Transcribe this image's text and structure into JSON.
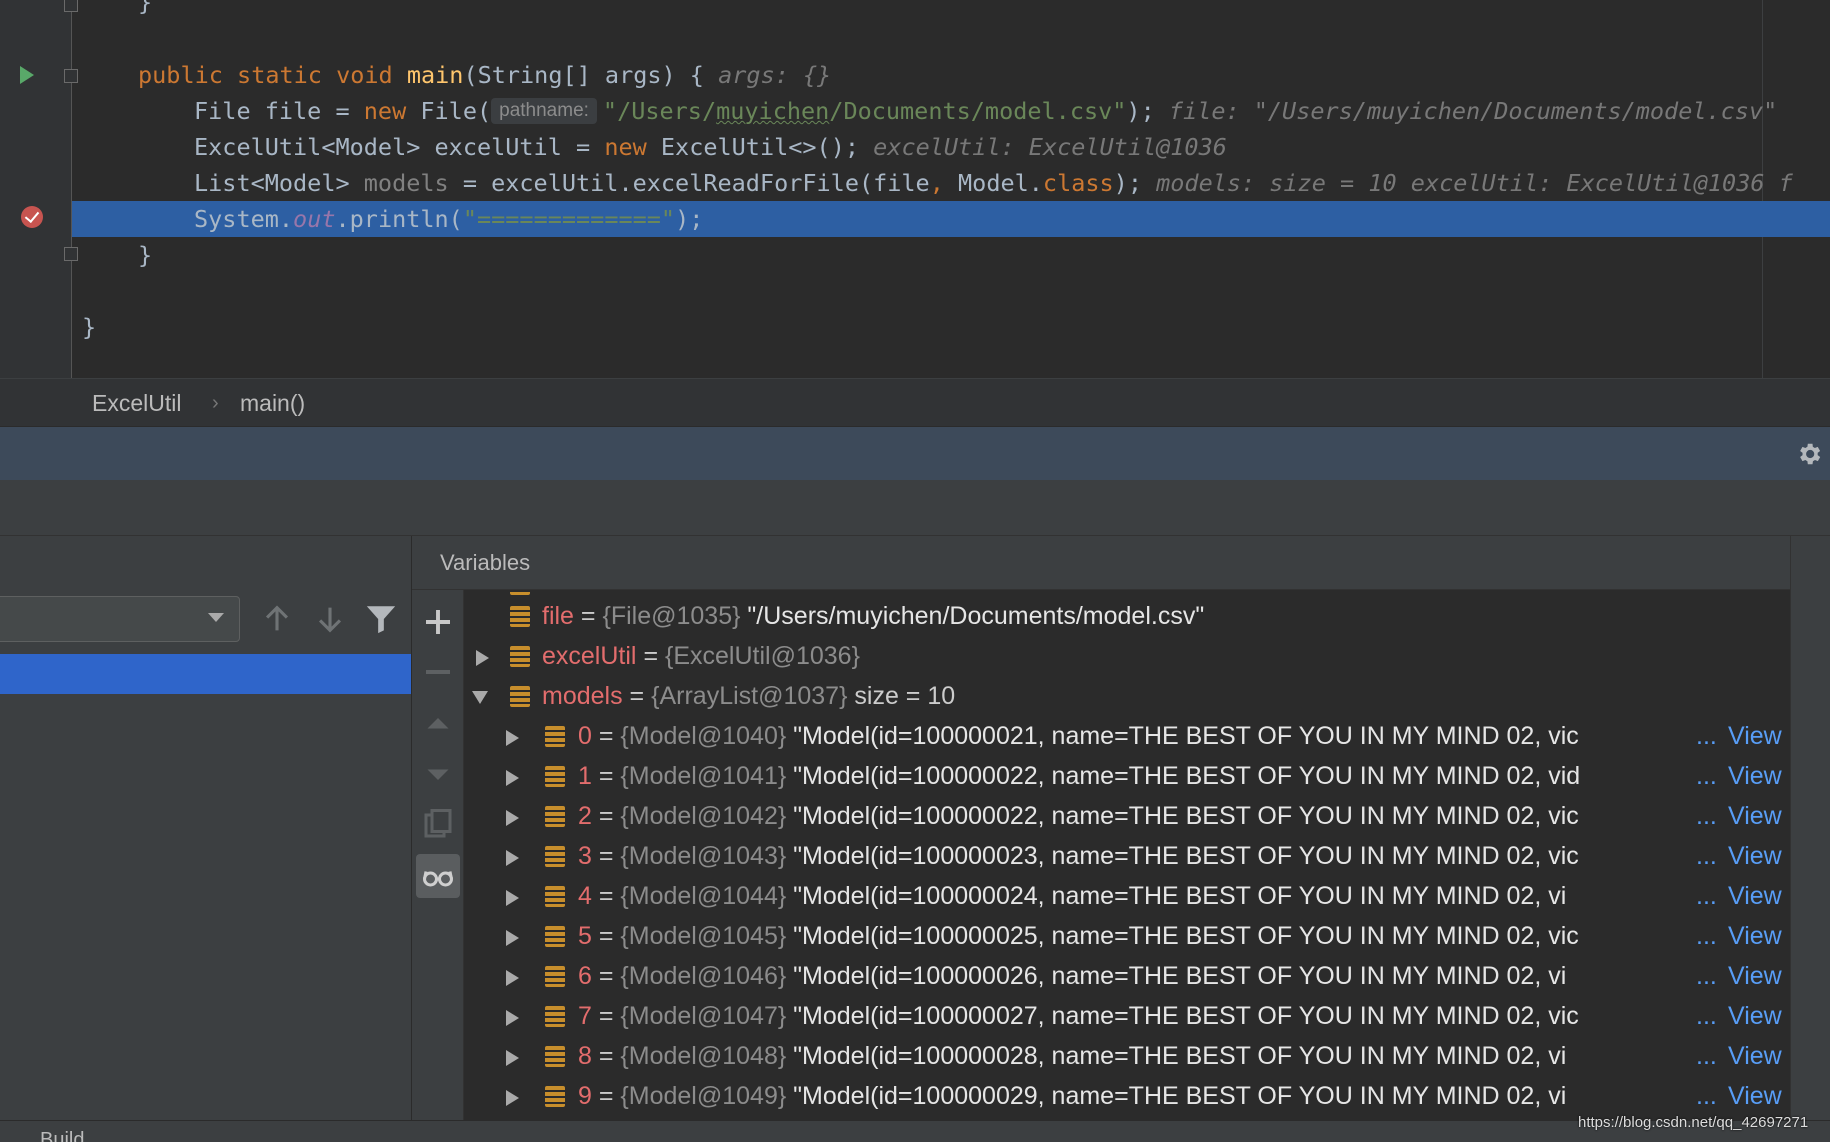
{
  "editor": {
    "lines": {
      "closing_brace_top": "}",
      "main_sig": {
        "mod1": "public",
        "mod2": "static",
        "type": "void",
        "name": "main",
        "params": "(String[] args) {",
        "hint": "args: {}"
      },
      "file_decl": {
        "pre": "File file = ",
        "kw_new": "new",
        "call": " File(",
        "param_hint": "pathname:",
        "str_a": "\"/Users/",
        "str_b": "muyichen",
        "str_c": "/Documents/model.csv\"",
        "end": ");",
        "hint": "file: \"/Users/muyichen/Documents/model.csv\""
      },
      "excel_decl": {
        "pre": "ExcelUtil<Model> excelUtil = ",
        "kw_new": "new",
        "call": " ExcelUtil<>();",
        "hint": "excelUtil: ExcelUtil@1036"
      },
      "models_decl": {
        "pre": "List<Model> ",
        "var": "models",
        "mid": " = excelUtil.excelReadForFile(file",
        "comma": ",",
        "mid2": " Model.",
        "kw_class": "class",
        "end": ");",
        "hint": "models:  size = 10  excelUtil: ExcelUtil@1036  f"
      },
      "println": {
        "pre": "System.",
        "field": "out",
        "call": ".println(",
        "str": "\"=============\"",
        "end": ");"
      },
      "method_close": "}",
      "class_close": "}"
    }
  },
  "breadcrumb": {
    "class_name": "ExcelUtil",
    "separator": "›",
    "method": "main()"
  },
  "variables": {
    "title": "Variables",
    "rows": [
      {
        "name": "file",
        "ref": "{File@1035}",
        "value": "\"/Users/muyichen/Documents/model.csv\""
      },
      {
        "name": "excelUtil",
        "ref": "{ExcelUtil@1036}",
        "value": ""
      },
      {
        "name": "models",
        "ref": "{ArrayList@1037}",
        "value": "size = 10"
      }
    ],
    "children": [
      {
        "index": "0",
        "ref": "{Model@1040}",
        "value": "\"Model(id=100000021, name=THE BEST OF YOU IN MY MIND 02, vic"
      },
      {
        "index": "1",
        "ref": "{Model@1041}",
        "value": "\"Model(id=100000022, name=THE BEST OF YOU IN MY MIND 02, vid"
      },
      {
        "index": "2",
        "ref": "{Model@1042}",
        "value": "\"Model(id=100000022, name=THE BEST OF YOU IN MY MIND 02, vic"
      },
      {
        "index": "3",
        "ref": "{Model@1043}",
        "value": "\"Model(id=100000023, name=THE BEST OF YOU IN MY MIND 02, vic"
      },
      {
        "index": "4",
        "ref": "{Model@1044}",
        "value": "\"Model(id=100000024, name=THE BEST OF YOU IN MY MIND 02, vi"
      },
      {
        "index": "5",
        "ref": "{Model@1045}",
        "value": "\"Model(id=100000025, name=THE BEST OF YOU IN MY MIND 02, vic"
      },
      {
        "index": "6",
        "ref": "{Model@1046}",
        "value": "\"Model(id=100000026, name=THE BEST OF YOU IN MY MIND 02, vi"
      },
      {
        "index": "7",
        "ref": "{Model@1047}",
        "value": "\"Model(id=100000027, name=THE BEST OF YOU IN MY MIND 02, vic"
      },
      {
        "index": "8",
        "ref": "{Model@1048}",
        "value": "\"Model(id=100000028, name=THE BEST OF YOU IN MY MIND 02, vi"
      },
      {
        "index": "9",
        "ref": "{Model@1049}",
        "value": "\"Model(id=100000029, name=THE BEST OF YOU IN MY MIND 02, vi"
      }
    ],
    "ellipsis": "...",
    "view_label": "View",
    "equals": "="
  },
  "status": {
    "build_label": "Build",
    "watermark": "https://blog.csdn.net/qq_42697271"
  },
  "icons": {
    "run": "run-gutter-icon",
    "breakpoint": "breakpoint-icon",
    "gear": "gear-icon",
    "add": "plus-icon",
    "remove": "minus-icon",
    "up": "arrow-up-icon",
    "down": "arrow-down-icon",
    "filter": "filter-icon",
    "copy": "copy-icon",
    "watch": "glasses-icon"
  },
  "colors": {
    "selection": "#2d5fa3",
    "frame_selected": "#2f65ca",
    "keyword": "#cc7832",
    "string": "#6a8759",
    "var_name": "#e36d6d",
    "link": "#589df6"
  }
}
